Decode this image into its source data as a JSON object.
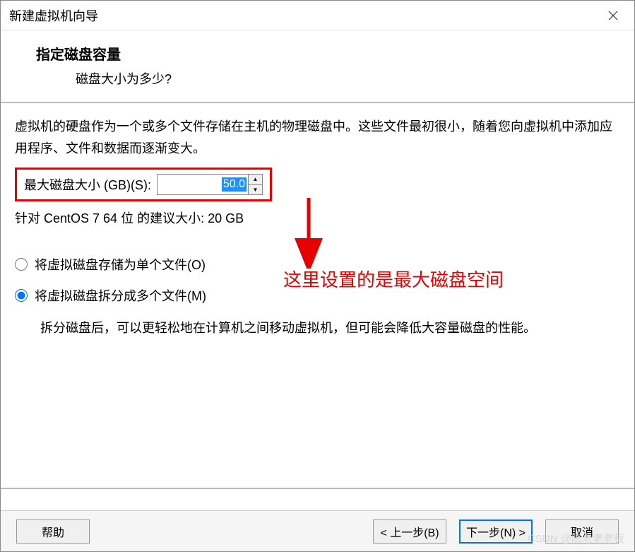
{
  "window": {
    "title": "新建虚拟机向导"
  },
  "header": {
    "title": "指定磁盘容量",
    "subtitle": "磁盘大小为多少?"
  },
  "content": {
    "description": "虚拟机的硬盘作为一个或多个文件存储在主机的物理磁盘中。这些文件最初很小，随着您向虚拟机中添加应用程序、文件和数据而逐渐变大。",
    "maxSizeLabel": "最大磁盘大小 (GB)(S):",
    "maxSizeValue": "50.0",
    "recommendation": "针对 CentOS 7 64 位 的建议大小: 20 GB",
    "radioSingle": "将虚拟磁盘存储为单个文件(O)",
    "radioSplit": "将虚拟磁盘拆分成多个文件(M)",
    "splitDescription": "拆分磁盘后，可以更轻松地在计算机之间移动虚拟机，但可能会降低大容量磁盘的性能。"
  },
  "annotation": {
    "text": "这里设置的是最大磁盘空间"
  },
  "buttons": {
    "help": "帮助",
    "back": "< 上一步(B)",
    "next": "下一步(N) >",
    "cancel": "取消"
  },
  "watermark": "CSDN @陈老老老板"
}
